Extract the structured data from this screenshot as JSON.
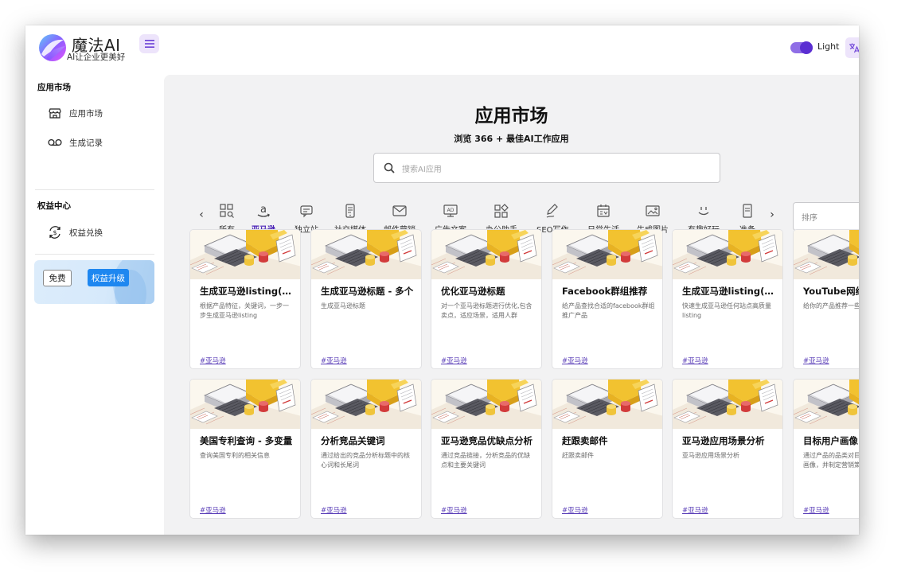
{
  "brand": {
    "name": "魔法AI",
    "tagline": "AI让企业更美好"
  },
  "header": {
    "theme_label": "Light",
    "lang_icon": "translate-icon"
  },
  "sidebar": {
    "sections": [
      {
        "title": "应用市场",
        "items": [
          {
            "label": "应用市场",
            "icon": "store-icon"
          },
          {
            "label": "生成记录",
            "icon": "voicemail-icon"
          }
        ]
      },
      {
        "title": "权益中心",
        "items": [
          {
            "label": "权益兑换",
            "icon": "exchange-icon"
          }
        ]
      }
    ],
    "promo": {
      "free_label": "免费",
      "upgrade_label": "权益升级"
    }
  },
  "main": {
    "title": "应用市场",
    "subtitle": "浏览 366 + 最佳AI工作应用",
    "search_placeholder": "搜索AI应用",
    "sort_placeholder": "排序",
    "categories": [
      {
        "label": "所有",
        "icon": "grid-search-icon",
        "active": false
      },
      {
        "label": "亚马逊",
        "icon": "amazon-icon",
        "active": true
      },
      {
        "label": "独立站",
        "icon": "chat-box-icon",
        "active": false
      },
      {
        "label": "社交媒体",
        "icon": "phone-icon",
        "active": false
      },
      {
        "label": "邮件营销",
        "icon": "mail-icon",
        "active": false
      },
      {
        "label": "广告文案",
        "icon": "ad-icon",
        "active": false
      },
      {
        "label": "办公助手",
        "icon": "shapes-icon",
        "active": false
      },
      {
        "label": "SEO写作",
        "icon": "pen-icon",
        "active": false
      },
      {
        "label": "日常生活",
        "icon": "calendar-icon",
        "active": false
      },
      {
        "label": "生成图片",
        "icon": "image-icon",
        "active": false
      },
      {
        "label": "有趣好玩",
        "icon": "smile-icon",
        "active": false
      },
      {
        "label": "准备",
        "icon": "doc-icon",
        "active": false
      }
    ],
    "cards": [
      {
        "title": "生成亚马逊listing(升级版)",
        "desc": "根据产品特征，关键词，一步一步生成亚马逊listing",
        "tag": "#亚马逊"
      },
      {
        "title": "生成亚马逊标题 - 多个",
        "desc": "生成亚马逊标题",
        "tag": "#亚马逊"
      },
      {
        "title": "优化亚马逊标题",
        "desc": "对一个亚马逊标题进行优化,包含卖点，适应场景，适用人群",
        "tag": "#亚马逊"
      },
      {
        "title": "Facebook群组推荐",
        "desc": "给产品查找合适的facebook群组推广产品",
        "tag": "#亚马逊"
      },
      {
        "title": "生成亚马逊listing(所有站点)",
        "desc": "快速生成亚马逊任何站点高质量listing",
        "tag": "#亚马逊"
      },
      {
        "title": "YouTube网红推荐",
        "desc": "给你的产品推荐一些合适的网红",
        "tag": "#亚马逊"
      },
      {
        "title": "美国专利查询 - 多变量",
        "desc": "查询美国专利的相关信息",
        "tag": "#亚马逊"
      },
      {
        "title": "分析竞品关键词",
        "desc": "通过给出的竞品分析标题中的核心词和长尾词",
        "tag": "#亚马逊"
      },
      {
        "title": "亚马逊竞品优缺点分析",
        "desc": "通过竞品链接，分析竞品的优缺点和主要关键词",
        "tag": "#亚马逊"
      },
      {
        "title": "赶跟卖邮件",
        "desc": "赶跟卖邮件",
        "tag": "#亚马逊"
      },
      {
        "title": "亚马逊应用场景分析",
        "desc": "亚马逊应用场景分析",
        "tag": "#亚马逊"
      },
      {
        "title": "目标用户画像",
        "desc": "通过产品的品类对目标用户进行画像，并制定营销策略",
        "tag": "#亚马逊"
      }
    ]
  },
  "colors": {
    "accent": "#5b2fd2",
    "accent_soft": "#ede4fb",
    "upgrade": "#1e87f0",
    "main_bg": "#f2f2f3"
  }
}
